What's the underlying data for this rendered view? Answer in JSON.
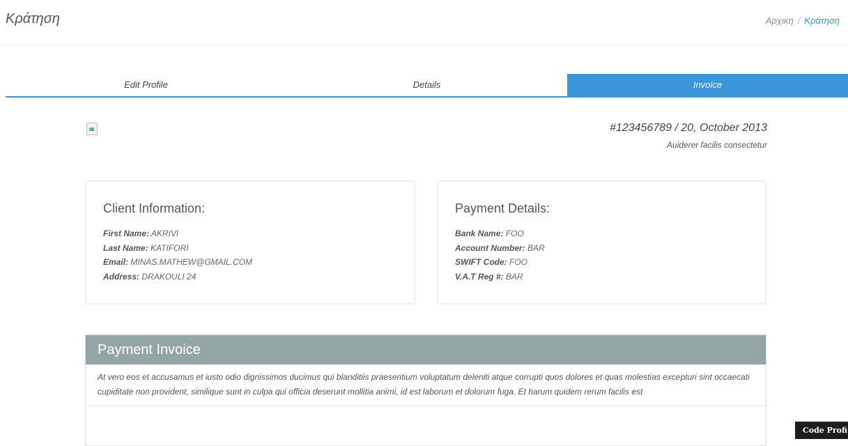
{
  "header": {
    "title": "Κράτηση",
    "breadcrumb": {
      "home": "Αρχικη",
      "separator": "/",
      "current": "Κράτηση"
    }
  },
  "tabs": [
    {
      "label": "Edit Profile",
      "active": false
    },
    {
      "label": "Details",
      "active": false
    },
    {
      "label": "Invoice",
      "active": true
    }
  ],
  "invoice": {
    "number_date": "#123456789 / 20, October 2013",
    "subtitle": "Auiderer facilis consectetur",
    "logo_icon": "broken-image-icon"
  },
  "client": {
    "heading": "Client Information:",
    "first_name_label": "First Name:",
    "first_name": "AKRIVI",
    "last_name_label": "Last Name:",
    "last_name": "KATIFORI",
    "email_label": "Email:",
    "email": "MINAS.MATHEW@GMAIL.COM",
    "address_label": "Address:",
    "address": "DRAKOULI 24"
  },
  "payment": {
    "heading": "Payment Details:",
    "bank_label": "Bank Name:",
    "bank": "FOO",
    "account_label": "Account Number:",
    "account": "BAR",
    "swift_label": "SWIFT Code:",
    "swift": "FOO",
    "vat_label": "V.A.T Reg #:",
    "vat": "BAR"
  },
  "payment_invoice": {
    "heading": "Payment Invoice",
    "body": "At vero eos et accusamus et iusto odio dignissimos ducimus qui blanditiis praesentium voluptatum deleniti atque corrupti quos dolores et quas molestias excepturi sint occaecati cupiditate non provident, similique sunt in culpa qui officia deserunt mollitia animi, id est laborum et dolorum fuga. Et harum quidem rerum facilis est"
  },
  "code_profile": {
    "label": "Code Profi"
  },
  "colors": {
    "accent": "#3a96d8",
    "panel_heading": "#93a5a5",
    "code_profile_bg": "#1d1d1d"
  }
}
